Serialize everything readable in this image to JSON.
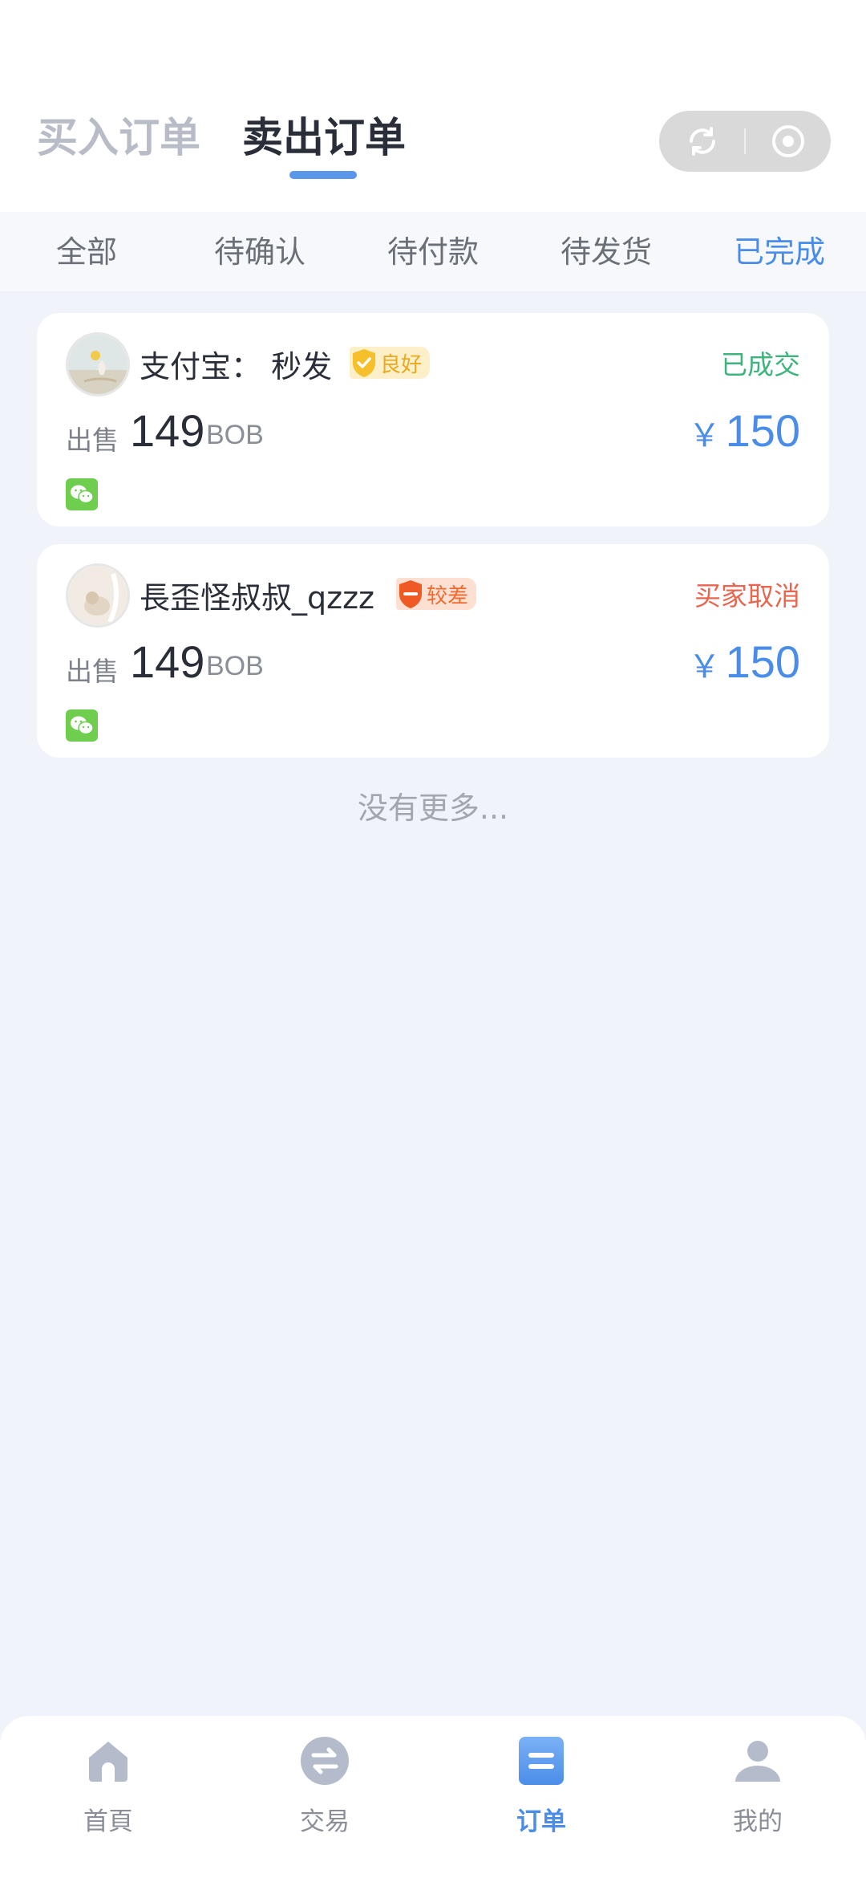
{
  "header": {
    "tabs": [
      {
        "label": "买入订单",
        "active": false
      },
      {
        "label": "卖出订单",
        "active": true
      }
    ],
    "capsule": {
      "left_icon": "refresh-icon",
      "right_icon": "record-icon"
    }
  },
  "filters": {
    "tabs": [
      {
        "label": "全部",
        "active": false
      },
      {
        "label": "待确认",
        "active": false
      },
      {
        "label": "待付款",
        "active": false
      },
      {
        "label": "待发货",
        "active": false
      },
      {
        "label": "已完成",
        "active": true
      }
    ],
    "active_color": "#4a8de8"
  },
  "orders": [
    {
      "nickname": "支付宝： 秒发",
      "reputation": "良好",
      "reputation_color": "#e9a81d",
      "status": "已成交",
      "status_color": "#3fb37d",
      "type_label": "出售",
      "amount": "149",
      "unit": "BOB",
      "currency": "￥",
      "price": "150",
      "payment_icon": "wechat-icon"
    },
    {
      "nickname": "長歪怪叔叔_qzzz",
      "reputation": "较差",
      "reputation_color": "#ef6a2e",
      "status": "买家取消",
      "status_color": "#e8664f",
      "type_label": "出售",
      "amount": "149",
      "unit": "BOB",
      "currency": "￥",
      "price": "150",
      "payment_icon": "wechat-icon"
    }
  ],
  "list_footer": "没有更多...",
  "bottom_nav": [
    {
      "label": "首頁",
      "icon": "home-icon",
      "active": false
    },
    {
      "label": "交易",
      "icon": "exchange-icon",
      "active": false
    },
    {
      "label": "订单",
      "icon": "order-icon",
      "active": true
    },
    {
      "label": "我的",
      "icon": "user-icon",
      "active": false
    }
  ]
}
